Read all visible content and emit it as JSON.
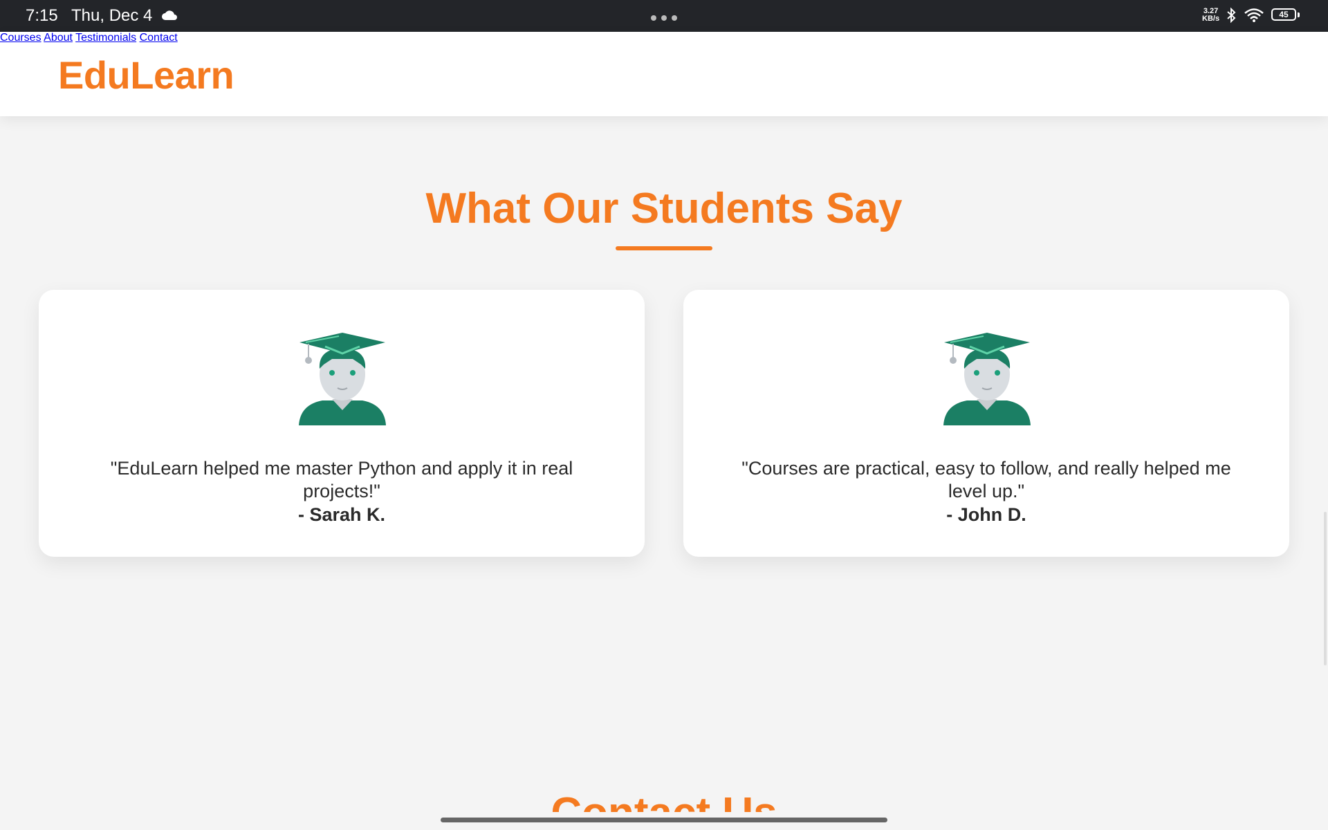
{
  "status_bar": {
    "time": "7:15",
    "date": "Thu, Dec 4",
    "net_speed_value": "3.27",
    "net_speed_unit": "KB/s",
    "battery": "45",
    "battery_level_percent": 45
  },
  "header": {
    "logo": "EduLearn",
    "nav": [
      "Courses",
      "About",
      "Testimonials",
      "Contact"
    ]
  },
  "testimonials": {
    "title": "What Our Students Say",
    "items": [
      {
        "quote": "\"EduLearn helped me master Python and apply it in real projects!\"",
        "author": "- Sarah K."
      },
      {
        "quote": "\"Courses are practical, easy to follow, and really helped me level up.\"",
        "author": "- John D."
      }
    ]
  },
  "next_section": {
    "title": "Contact Us"
  },
  "colors": {
    "accent": "#f47a20",
    "status_bar": "#232529",
    "background": "#f4f4f4",
    "avatar_green": "#1b7f64"
  },
  "icons": [
    "cloud-icon",
    "more-dots-icon",
    "bluetooth-icon",
    "wifi-icon",
    "battery-icon",
    "student-avatar-icon"
  ]
}
